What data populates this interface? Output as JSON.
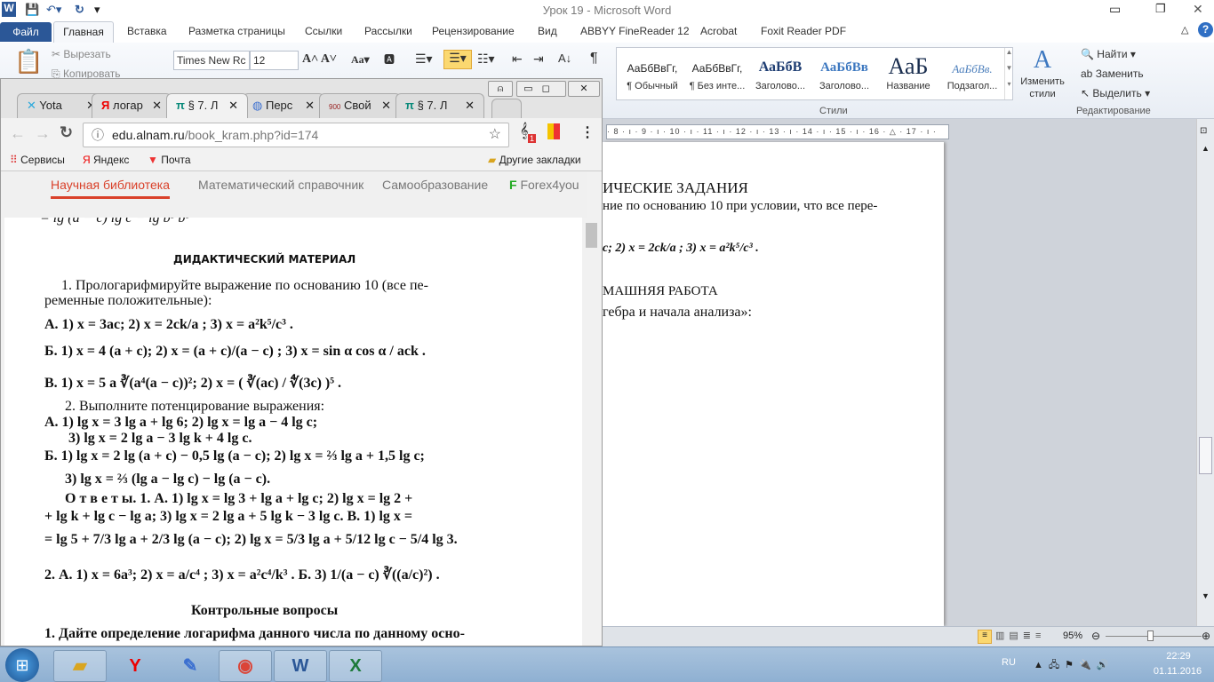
{
  "word": {
    "title": "Урок 19  -  Microsoft Word",
    "tabs": [
      "Файл",
      "Главная",
      "Вставка",
      "Разметка страницы",
      "Ссылки",
      "Рассылки",
      "Рецензирование",
      "Вид",
      "ABBYY FineReader 12",
      "Acrobat",
      "Foxit Reader PDF"
    ],
    "clipboard": {
      "cut": "Вырезать",
      "copy": "Копировать"
    },
    "font": {
      "name": "Times New Rc",
      "size": "12"
    },
    "styles": [
      {
        "preview": "АаБбВвГг,",
        "label": "¶ Обычный"
      },
      {
        "preview": "АаБбВвГг,",
        "label": "¶ Без инте..."
      },
      {
        "preview": "АаБбВ",
        "label": "Заголово..."
      },
      {
        "preview": "АаБбВв",
        "label": "Заголово..."
      },
      {
        "preview": "АаБ",
        "label": "Название"
      },
      {
        "preview": "АаБбВв.",
        "label": "Подзагол..."
      }
    ],
    "change_styles": "Изменить стили",
    "styles_group": "Стили",
    "editing": {
      "find": "Найти",
      "replace": "Заменить",
      "select": "Выделить",
      "group": "Редактирование"
    },
    "ruler": "· 8 · ı · 9 · ı · 10 · ı · 11 · ı · 12 · ı · 13 · ı · 14 · ı · 15 · ı · 16 · △ · 17 · ı ·",
    "page_lines": [
      "ИЧЕСКИЕ ЗАДАНИЯ",
      "ние по основанию 10 при условии, что все пере-",
      "c;  2)  x = 2ck/a ;  3)  x = a²k⁵/c³ .",
      "МАШНЯЯ РАБОТА",
      "гебра и начала анализа»:"
    ],
    "zoom": "95%",
    "zoom_level_percent": 95
  },
  "chrome": {
    "tabs": [
      {
        "title": "Yota",
        "icon": "yota-icon"
      },
      {
        "title": "логар",
        "icon": "yandex-icon"
      },
      {
        "title": "§ 7. Л",
        "icon": "pi-icon",
        "active": true
      },
      {
        "title": "Перс",
        "icon": "globe-icon"
      },
      {
        "title": "Свой",
        "icon": "900-games-icon"
      },
      {
        "title": "§ 7. Л",
        "icon": "pi-icon"
      }
    ],
    "url_host": "edu.alnam.ru",
    "url_path": "/book_kram.php?id=174",
    "extension_badge": "1",
    "bookmarks": [
      "Сервисы",
      "Яндекс",
      "Почта"
    ],
    "other_bookmarks": "Другие закладки",
    "site_nav": [
      {
        "label": "Научная библиотека",
        "active": true
      },
      {
        "label": "Математический справочник"
      },
      {
        "label": "Самообразование"
      },
      {
        "label": "Forex4you"
      }
    ],
    "accent": "#d9412a"
  },
  "book": {
    "lines": [
      "= lg (a − c)   lg c − lg  b³          b⁵",
      "ДИДАКТИЧЕСКИЙ МАТЕРИАЛ",
      "1. Прологарифмируйте выражение по основанию 10 (все пе-",
      "ременные положительные):",
      "А. 1) x = 3ac;  2) x = 2ck/a ;  3) x = a²k⁵/c³ .",
      "Б. 1) x = 4 (a + c);  2) x = (a + c)/(a − c) ;  3) x = sin α cos α / ack .",
      "В. 1) x = 5 a ∛(a⁴(a − c))²;  2) x = ( ∛(ac) / ∜(3c) )⁵ .",
      "2.   Выполните потенцирование выражения:",
      "А. 1) lg x = 3 lg a + lg 6;  2) lg x = lg a − 4 lg c;",
      "3) lg x = 2 lg a − 3 lg k + 4 lg c.",
      "Б. 1) lg x = 2 lg (a + c) − 0,5 lg (a − c);  2) lg x = ⅔ lg a + 1,5 lg c;",
      "3) lg x = ⅔ (lg a − lg c) − lg (a − c).",
      "О т в е т ы. 1. А. 1) lg x = lg 3 + lg a + lg c;    2) lg x = lg 2 +",
      "+ lg k + lg c − lg a;  3) lg x = 2 lg a + 5 lg k − 3 lg c.  В. 1) lg x =",
      "= lg 5 + 7/3 lg a + 2/3 lg (a − c);  2)  lg x = 5/3 lg a + 5/12 lg c − 5/4 lg 3.",
      "2. А. 1) x = 6a³;  2) x = a/c⁴ ;      3) x = a²c⁴/k³ .  Б. 3) 1/(a − c) ∛((a/c)²) .",
      "Контрольные вопросы",
      "1. Дайте определение логарифма данного числа по данному осно-"
    ]
  },
  "taskbar": {
    "apps": [
      "windows-explorer",
      "yandex-browser",
      "paint",
      "chrome",
      "word",
      "excel"
    ],
    "lang": "RU",
    "time": "22:29",
    "date": "01.11.2016"
  }
}
